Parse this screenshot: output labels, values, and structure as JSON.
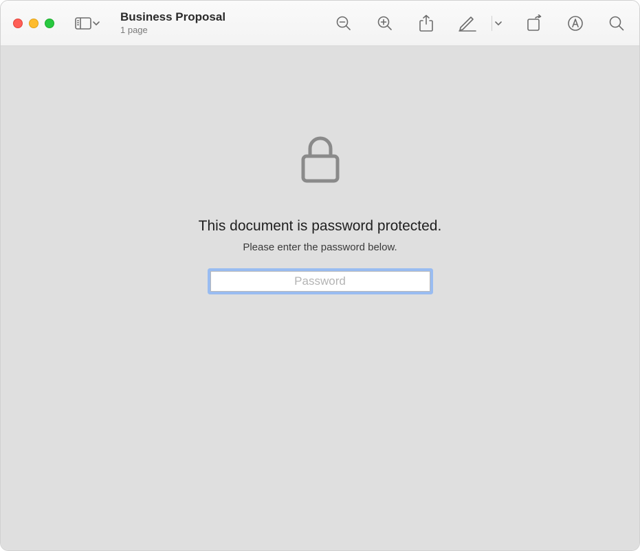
{
  "window": {
    "title": "Business Proposal",
    "subtitle": "1 page"
  },
  "content": {
    "heading": "This document is password protected.",
    "subheading": "Please enter the password below.",
    "password_placeholder": "Password"
  },
  "icons": {
    "sidebar": "sidebar-icon",
    "zoom_out": "zoom-out-icon",
    "zoom_in": "zoom-in-icon",
    "share": "share-icon",
    "markup": "pencil-icon",
    "rotate": "rotate-icon",
    "highlight": "highlight-icon",
    "search": "search-icon",
    "lock": "lock-icon"
  }
}
